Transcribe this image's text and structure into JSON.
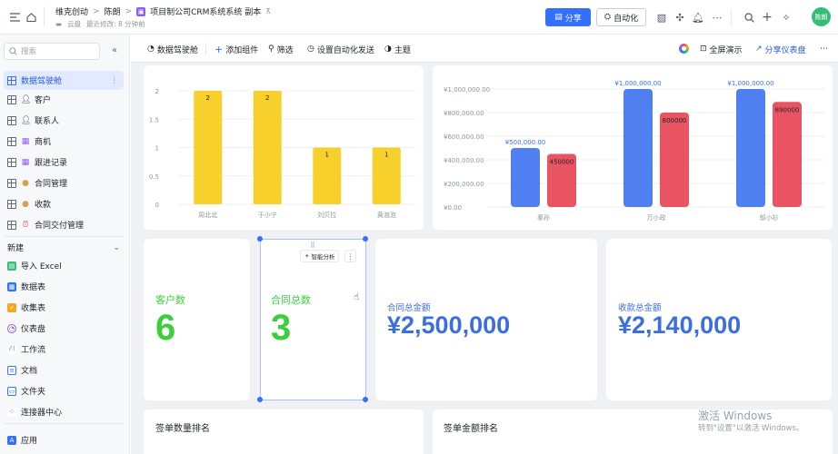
{
  "header": {
    "breadcrumb": [
      "维克创动",
      "陈朗"
    ],
    "doc_title": "项目制公司CRM系统系统 副本",
    "location": "云盘",
    "last_modified": "最近修改: 8 分钟前",
    "share_label": "分享",
    "automation_label": "自动化",
    "avatar_text": "陈朗"
  },
  "sidebar": {
    "search_placeholder": "搜索",
    "items": [
      {
        "label": "数据驾驶舱",
        "icon": "dashboard-icon",
        "active": true
      },
      {
        "label": "客户",
        "icon": "person-emoji"
      },
      {
        "label": "联系人",
        "icon": "person-emoji"
      },
      {
        "label": "商机",
        "icon": "chart-emoji"
      },
      {
        "label": "跟进记录",
        "icon": "chart-emoji"
      },
      {
        "label": "合同管理",
        "icon": "moneybag-emoji"
      },
      {
        "label": "收款",
        "icon": "moneybag-emoji"
      },
      {
        "label": "合同交付管理",
        "icon": "alarm-emoji"
      }
    ],
    "new_label": "新建",
    "new_items": [
      {
        "label": "导入 Excel",
        "icon": "excel-icon"
      },
      {
        "label": "数据表",
        "icon": "table-icon"
      },
      {
        "label": "收集表",
        "icon": "form-icon"
      },
      {
        "label": "仪表盘",
        "icon": "dashboard-icon"
      },
      {
        "label": "工作流",
        "icon": "workflow-icon"
      },
      {
        "label": "文档",
        "icon": "doc-icon"
      },
      {
        "label": "文件夹",
        "icon": "folder-icon"
      },
      {
        "label": "连接器中心",
        "icon": "connector-icon"
      }
    ],
    "apps_label": "应用"
  },
  "toolbar": {
    "dashboard_name": "数据驾驶舱",
    "add_component": "添加组件",
    "filter": "筛选",
    "auto_send": "设置自动化发送",
    "theme": "主题",
    "fullscreen": "全屏演示",
    "share_dashboard": "分享仪表盘"
  },
  "colors": {
    "accent": "#3370ff",
    "yellow_bar": "#f8d02b",
    "blue_bar": "#4f7ff0",
    "red_bar": "#e85462",
    "kpi_green": "#3ccf3c",
    "kpi_blue": "#3b6fe0"
  },
  "chart_data": [
    {
      "type": "bar",
      "categories": [
        "周北北",
        "于小宁",
        "刘贝拉",
        "黄泡泡"
      ],
      "values": [
        2,
        2,
        1,
        1
      ],
      "yticks": [
        "0",
        "0.5",
        "1",
        "1.5",
        "2"
      ],
      "ylim": [
        0,
        2
      ]
    },
    {
      "type": "bar",
      "categories": [
        "秦孙",
        "万小政",
        "邬小衫"
      ],
      "series": [
        {
          "values": [
            500000,
            1000000,
            1000000
          ],
          "labels": [
            "¥500,000.00",
            "¥1,000,000.00",
            "¥1,000,000.00"
          ]
        },
        {
          "values": [
            450000,
            800000,
            890000
          ],
          "labels": [
            "450000",
            "800000",
            "890000"
          ]
        }
      ],
      "yticks": [
        "¥0.00",
        "¥200,000.00",
        "¥400,000.00",
        "¥600,000.00",
        "¥800,000.00",
        "¥1,000,000.00"
      ],
      "ylim": [
        0,
        1000000
      ]
    }
  ],
  "kpis": [
    {
      "title": "客户数",
      "value": "6"
    },
    {
      "title": "合同总数",
      "value": "3"
    },
    {
      "title": "合同总金额",
      "value": "¥2,500,000"
    },
    {
      "title": "收款总金额",
      "value": "¥2,140,000"
    }
  ],
  "smart_analysis": "智能分析",
  "rank_titles": [
    "签单数量排名",
    "签单金额排名"
  ],
  "watermark": {
    "line1": "激活 Windows",
    "line2": "转到\"设置\"以激活 Windows。"
  }
}
